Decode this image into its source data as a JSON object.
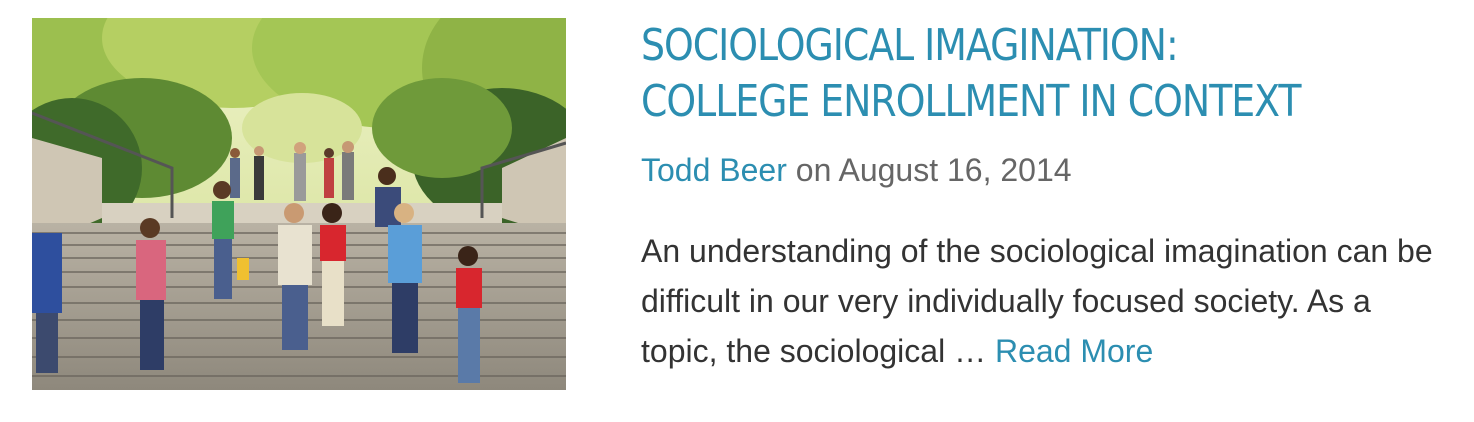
{
  "post": {
    "title": "Sociological Imagination: College Enrollment in Context",
    "author": "Todd Beer",
    "date_prefix": "on",
    "date": "August 16, 2014",
    "excerpt": "An understanding of the sociological imagination can be difficult in our very individually focused society. As a topic, the sociological",
    "ellipsis": "…",
    "read_more_label": "Read More"
  },
  "colors": {
    "link": "#2c8eb1",
    "meta_text": "#666666",
    "body_text": "#333333"
  },
  "image": {
    "subject": "students-walking-down-campus-stairs-photo"
  }
}
